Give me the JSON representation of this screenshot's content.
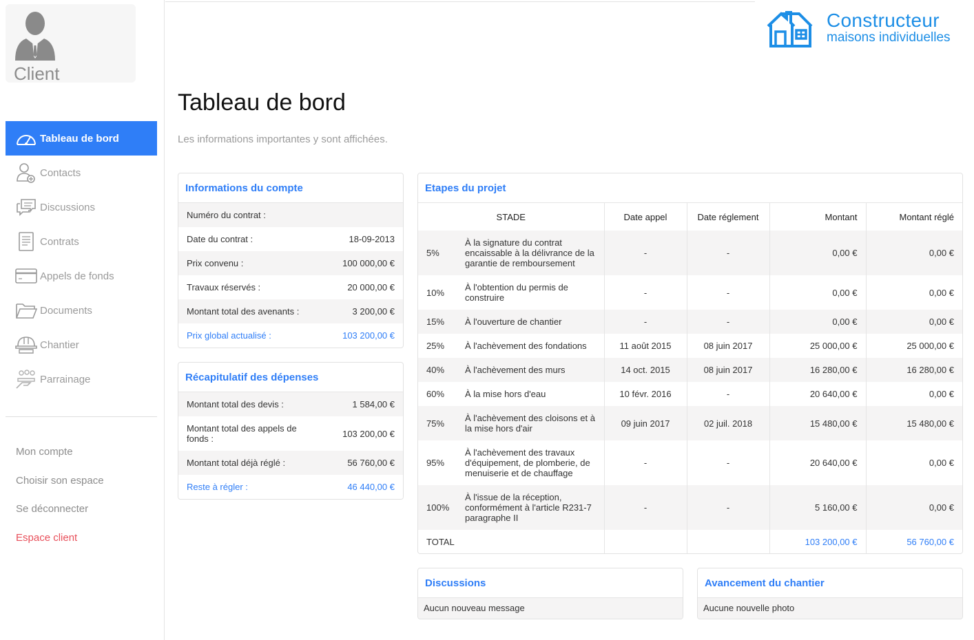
{
  "sidebar": {
    "role": "Client",
    "nav": [
      {
        "label": "Tableau de bord",
        "icon": "dashboard-gauge-icon",
        "active": true
      },
      {
        "label": "Contacts",
        "icon": "contact-user-icon"
      },
      {
        "label": "Discussions",
        "icon": "chat-bubbles-icon"
      },
      {
        "label": "Contrats",
        "icon": "document-icon"
      },
      {
        "label": "Appels de fonds",
        "icon": "credit-card-icon"
      },
      {
        "label": "Documents",
        "icon": "folder-icon"
      },
      {
        "label": "Chantier",
        "icon": "hard-hat-icon"
      },
      {
        "label": "Parrainage",
        "icon": "sponsorship-hands-icon"
      }
    ],
    "links": [
      "Mon compte",
      "Choisir son espace",
      "Se déconnecter",
      "Espace client"
    ]
  },
  "logo": {
    "line1": "Constructeur",
    "line2": "maisons individuelles"
  },
  "page": {
    "title": "Tableau de bord",
    "subtitle": "Les informations importantes y sont affichées."
  },
  "account": {
    "title": "Informations du compte",
    "rows": [
      {
        "label": "Numéro du contrat :",
        "value": ""
      },
      {
        "label": "Date du contrat :",
        "value": "18-09-2013"
      },
      {
        "label": "Prix convenu :",
        "value": "100 000,00 €"
      },
      {
        "label": "Travaux réservés :",
        "value": "20 000,00 €"
      },
      {
        "label": "Montant total des avenants :",
        "value": "3 200,00 €"
      },
      {
        "label": "Prix global actualisé :",
        "value": "103 200,00 €"
      }
    ]
  },
  "expenses": {
    "title": "Récapitulatif des dépenses",
    "rows": [
      {
        "label": "Montant total des devis :",
        "value": "1 584,00 €"
      },
      {
        "label": "Montant total des appels de fonds :",
        "value": "103 200,00 €"
      },
      {
        "label": "Montant total déjà réglé :",
        "value": "56 760,00 €"
      },
      {
        "label": "Reste à régler :",
        "value": "46 440,00 €"
      }
    ]
  },
  "project": {
    "title": "Etapes du projet",
    "headers": [
      "STADE",
      "Date appel",
      "Date réglement",
      "Montant",
      "Montant réglé"
    ],
    "rows": [
      {
        "pct": "5%",
        "stade": "À la signature du contrat encaissable à la délivrance de la garantie de remboursement",
        "date_appel": "-",
        "date_reglement": "-",
        "montant": "0,00 €",
        "montant_regle": "0,00 €"
      },
      {
        "pct": "10%",
        "stade": "À l'obtention du permis de construire",
        "date_appel": "-",
        "date_reglement": "-",
        "montant": "0,00 €",
        "montant_regle": "0,00 €"
      },
      {
        "pct": "15%",
        "stade": "À l'ouverture de chantier",
        "date_appel": "-",
        "date_reglement": "-",
        "montant": "0,00 €",
        "montant_regle": "0,00 €"
      },
      {
        "pct": "25%",
        "stade": "À l'achèvement des fondations",
        "date_appel": "11 août 2015",
        "date_reglement": "08 juin 2017",
        "montant": "25 000,00 €",
        "montant_regle": "25 000,00 €"
      },
      {
        "pct": "40%",
        "stade": "À l'achèvement des murs",
        "date_appel": "14 oct. 2015",
        "date_reglement": "08 juin 2017",
        "montant": "16 280,00 €",
        "montant_regle": "16 280,00 €"
      },
      {
        "pct": "60%",
        "stade": "À la mise hors d'eau",
        "date_appel": "10 févr. 2016",
        "date_reglement": "-",
        "montant": "20 640,00 €",
        "montant_regle": "0,00 €"
      },
      {
        "pct": "75%",
        "stade": "À l'achèvement des cloisons et à la mise hors d'air",
        "date_appel": "09 juin 2017",
        "date_reglement": "02 juil. 2018",
        "montant": "15 480,00 €",
        "montant_regle": "15 480,00 €"
      },
      {
        "pct": "95%",
        "stade": "À l'achèvement des travaux d'équipement, de plomberie, de menuiserie et de chauffage",
        "date_appel": "-",
        "date_reglement": "-",
        "montant": "20 640,00 €",
        "montant_regle": "0,00 €"
      },
      {
        "pct": "100%",
        "stade": "À l'issue de la réception, conformément à l'article R231-7 paragraphe II",
        "date_appel": "-",
        "date_reglement": "-",
        "montant": "5 160,00 €",
        "montant_regle": "0,00 €"
      }
    ],
    "total": {
      "label": "TOTAL",
      "montant": "103 200,00 €",
      "montant_regle": "56 760,00 €"
    }
  },
  "discussions": {
    "title": "Discussions",
    "message": "Aucun nouveau message"
  },
  "progress": {
    "title": "Avancement du chantier",
    "message": "Aucune nouvelle photo"
  },
  "colors": {
    "accent": "#2f7ef7",
    "logo": "#1c8ee6",
    "danger": "#e8505b"
  }
}
